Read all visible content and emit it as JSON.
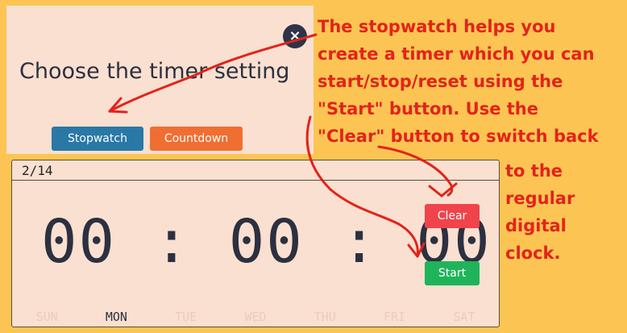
{
  "dialog": {
    "close_symbol": "×",
    "title": "Choose the timer setting",
    "buttons": {
      "stopwatch": "Stopwatch",
      "countdown": "Countdown"
    }
  },
  "clock": {
    "date": "2/14",
    "time": "00 : 00 : 00",
    "clear_label": "Clear",
    "start_label": "Start",
    "weekdays": [
      "SUN",
      "MON",
      "TUE",
      "WED",
      "THU",
      "FRI",
      "SAT"
    ],
    "active_weekday": "MON"
  },
  "annotation": {
    "lines": [
      "The stopwatch helps you",
      "create a timer which you can",
      "start/stop/reset using the",
      "\"Start\" button. Use the",
      "\"Clear\" button to switch back"
    ],
    "continuation": [
      "to the",
      "regular",
      "digital",
      "clock."
    ]
  },
  "colors": {
    "background": "#FCC553",
    "panel": "#FAE0D0",
    "stopwatch": "#2978A6",
    "countdown": "#F06E32",
    "clear": "#F0434B",
    "start": "#1FB45A",
    "annotation": "#E3231A"
  }
}
